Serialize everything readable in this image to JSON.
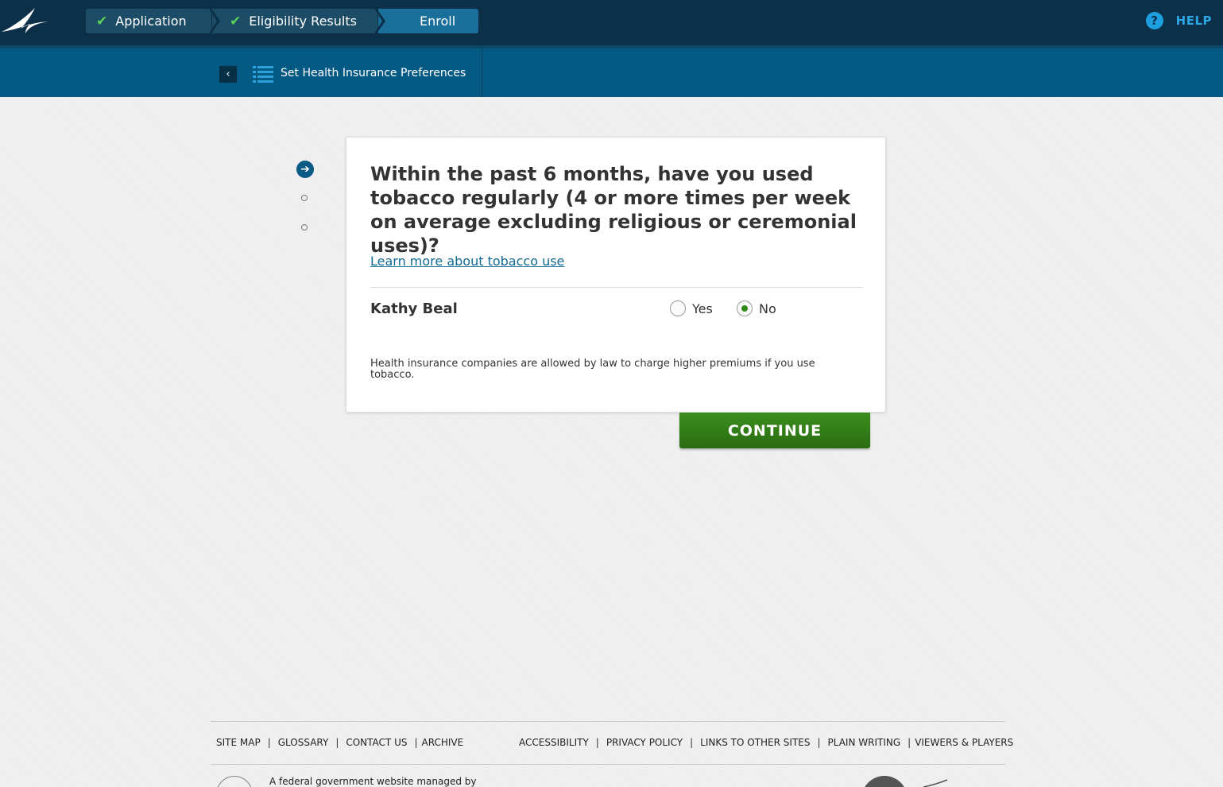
{
  "header": {
    "steps": [
      {
        "label": "Application",
        "completed": true
      },
      {
        "label": "Eligibility Results",
        "completed": true
      },
      {
        "label": "Enroll",
        "completed": false,
        "active": true
      }
    ],
    "help_label": "HELP",
    "help_icon": "?"
  },
  "subheader": {
    "title": "Set Health Insurance Preferences",
    "back_icon": "‹"
  },
  "progress": {
    "current_icon": "➔",
    "total_steps": 3,
    "current_step": 1
  },
  "question": {
    "text": "Within the past 6 months, have you used tobacco regularly (4 or more times per week on average excluding religious or ceremonial uses)?",
    "learn_more": "Learn more about tobacco use",
    "person": "Kathy Beal",
    "options": [
      {
        "label": "Yes",
        "selected": false
      },
      {
        "label": "No",
        "selected": true
      }
    ],
    "disclaimer": "Health insurance companies are allowed by law to charge higher premiums if you use tobacco."
  },
  "actions": {
    "continue_label": "CONTINUE"
  },
  "footer": {
    "left_links": [
      "SITE MAP",
      "GLOSSARY",
      "CONTACT US",
      "ARCHIVE"
    ],
    "right_links": [
      "ACCESSIBILITY",
      "PRIVACY POLICY",
      "LINKS TO OTHER SITES",
      "PLAIN WRITING",
      "VIEWERS & PLAYERS"
    ],
    "managed_by": "A federal government website managed by"
  },
  "colors": {
    "topbar": "#0b3048",
    "subbar": "#045a83",
    "continue": "#2f7d15",
    "link": "#0f6a96",
    "check": "#5bd15b"
  }
}
